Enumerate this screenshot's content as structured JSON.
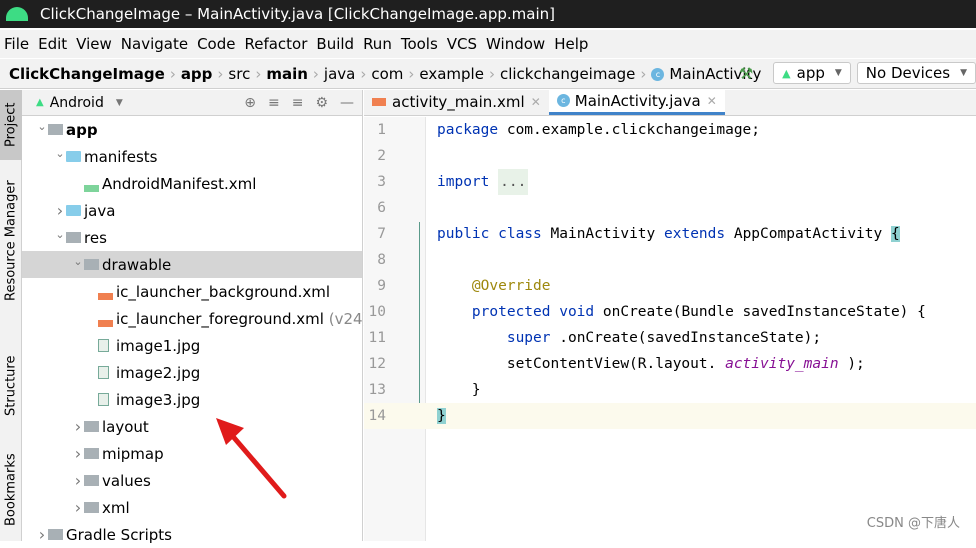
{
  "window": {
    "title": "ClickChangeImage – MainActivity.java [ClickChangeImage.app.main]"
  },
  "menu": [
    "File",
    "Edit",
    "View",
    "Navigate",
    "Code",
    "Refactor",
    "Build",
    "Run",
    "Tools",
    "VCS",
    "Window",
    "Help"
  ],
  "breadcrumb": [
    {
      "label": "ClickChangeImage",
      "bold": true
    },
    {
      "label": "app",
      "bold": true
    },
    {
      "label": "src"
    },
    {
      "label": "main",
      "bold": true
    },
    {
      "label": "java"
    },
    {
      "label": "com"
    },
    {
      "label": "example"
    },
    {
      "label": "clickchangeimage"
    },
    {
      "label": "MainActivity",
      "icon": "class-icon"
    }
  ],
  "run": {
    "config": "app",
    "device": "No Devices"
  },
  "side_tabs": [
    "Project",
    "Resource Manager",
    "Structure",
    "Bookmarks"
  ],
  "project": {
    "view": "Android",
    "tree": [
      {
        "label": "app",
        "bold": true,
        "level": 0,
        "arrow": "down",
        "icon": "module"
      },
      {
        "label": "manifests",
        "level": 1,
        "arrow": "down",
        "icon": "folder"
      },
      {
        "label": "AndroidManifest.xml",
        "level": 2,
        "icon": "manifest"
      },
      {
        "label": "java",
        "level": 1,
        "arrow": "right",
        "icon": "folder"
      },
      {
        "label": "res",
        "level": 1,
        "arrow": "down",
        "icon": "res"
      },
      {
        "label": "drawable",
        "level": 2,
        "arrow": "down",
        "icon": "gfolder",
        "selected": true
      },
      {
        "label": "ic_launcher_background.xml",
        "level": 3,
        "icon": "xml"
      },
      {
        "label": "ic_launcher_foreground.xml",
        "suffix": "(v24)",
        "level": 3,
        "icon": "xml"
      },
      {
        "label": "image1.jpg",
        "level": 3,
        "icon": "image"
      },
      {
        "label": "image2.jpg",
        "level": 3,
        "icon": "image"
      },
      {
        "label": "image3.jpg",
        "level": 3,
        "icon": "image"
      },
      {
        "label": "layout",
        "level": 2,
        "arrow": "right",
        "icon": "gfolder"
      },
      {
        "label": "mipmap",
        "level": 2,
        "arrow": "right",
        "icon": "gfolder"
      },
      {
        "label": "values",
        "level": 2,
        "arrow": "right",
        "icon": "gfolder"
      },
      {
        "label": "xml",
        "level": 2,
        "arrow": "right",
        "icon": "gfolder"
      },
      {
        "label": "Gradle Scripts",
        "level": 0,
        "arrow": "right",
        "icon": "gradle"
      }
    ]
  },
  "tabs": [
    {
      "label": "activity_main.xml",
      "active": false
    },
    {
      "label": "MainActivity.java",
      "active": true
    }
  ],
  "code": [
    [
      [
        "kw",
        "package"
      ],
      [
        "",
        "com.example.clickchangeimage;"
      ]
    ],
    [],
    [
      [
        "kw",
        "import"
      ],
      [
        "fold",
        "..."
      ]
    ],
    [],
    [
      [
        "kw",
        "public class"
      ],
      [
        "",
        "MainActivity"
      ],
      [
        "kw",
        "extends"
      ],
      [
        "",
        "AppCompatActivity"
      ],
      [
        "brace",
        "{"
      ]
    ],
    [],
    [
      [
        "",
        "    "
      ],
      [
        "an",
        "@Override"
      ]
    ],
    [
      [
        "",
        "    "
      ],
      [
        "kw",
        "protected void"
      ],
      [
        "",
        "onCreate(Bundle savedInstanceState) {"
      ]
    ],
    [
      [
        "",
        "        "
      ],
      [
        "kw",
        "super"
      ],
      [
        "",
        ".onCreate(savedInstanceState);"
      ]
    ],
    [
      [
        "",
        "        setContentView(R.layout."
      ],
      [
        "it",
        "activity_main"
      ],
      [
        "",
        ");"
      ]
    ],
    [
      [
        "",
        "    }"
      ]
    ],
    [
      [
        "brace",
        "}"
      ]
    ]
  ],
  "line_numbers": [
    "1",
    "2",
    "3",
    "6",
    "7",
    "8",
    "9",
    "10",
    "11",
    "12",
    "13",
    "14"
  ],
  "current_line": "14",
  "watermark": "CSDN @下唐人",
  "annotation_color": "#e01b1b"
}
